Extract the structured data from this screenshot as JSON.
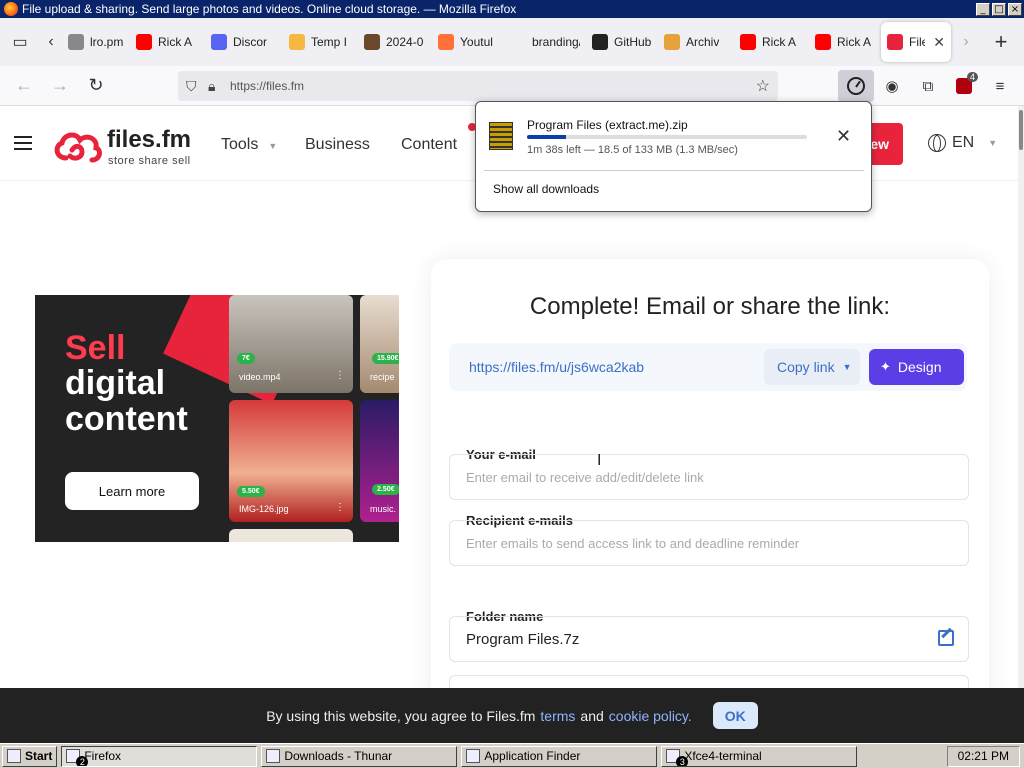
{
  "window": {
    "title": "File upload & sharing. Send large photos and videos. Online cloud storage. — Mozilla Firefox",
    "buttons": [
      "_",
      "□",
      "×"
    ]
  },
  "tabs": [
    {
      "label": "lro.pm",
      "fav": "#888888"
    },
    {
      "label": "Rick A",
      "fav": "#ff0000"
    },
    {
      "label": "Discor",
      "fav": "#5865f2"
    },
    {
      "label": "Temp I",
      "fav": "#f5b942"
    },
    {
      "label": "2024-0",
      "fav": "#6b4a2b"
    },
    {
      "label": "Youtul",
      "fav": "#ff7139"
    },
    {
      "label": "branding/ca",
      "fav": "#f0f0f4"
    },
    {
      "label": "GitHub",
      "fav": "#222222"
    },
    {
      "label": "Archiv",
      "fav": "#e8a23a"
    },
    {
      "label": "Rick A",
      "fav": "#ff0000"
    },
    {
      "label": "Rick A",
      "fav": "#ff0000"
    },
    {
      "label": "File",
      "fav": "#e8243d",
      "active": true
    }
  ],
  "nav": {
    "url": "https://files.fm",
    "downloads_badge": "4"
  },
  "site": {
    "logo_word": "files.fm",
    "logo_tag": "store share sell",
    "menu": {
      "tools": "Tools",
      "business": "Business",
      "content": "Content"
    },
    "red_button": "ew",
    "lang": "EN"
  },
  "promo": {
    "sell": "Sell",
    "line2": "digital",
    "line3": "content",
    "learn_more": "Learn more",
    "tiles": [
      {
        "price": "7€",
        "name": "video.mp4"
      },
      {
        "price": "15.90€",
        "name": "recipe"
      },
      {
        "price": "5.50€",
        "name": "IMG-126.jpg"
      },
      {
        "price": "2.50€",
        "name": "music."
      }
    ]
  },
  "share": {
    "heading": "Complete! Email or share the link:",
    "link": "https://files.fm/u/js6wca2kab",
    "copy_link": "Copy link",
    "design": "Design",
    "your_email_label": "Your e-mail",
    "your_email_placeholder": "Enter email to receive add/edit/delete link",
    "recipients_label": "Recipient e-mails",
    "recipients_placeholder": "Enter emails to send access link to and deadline reminder",
    "folder_label": "Folder name",
    "folder_value": "Program Files.7z"
  },
  "cookie": {
    "text_before": "By using this website, you agree to Files.fm",
    "terms": "terms",
    "and": "and",
    "policy": "cookie policy.",
    "ok": "OK"
  },
  "download": {
    "filename": "Program Files (extract.me).zip",
    "progress_fraction": 0.139,
    "status": "1m 38s left — 18.5 of 133 MB (1.3 MB/sec)",
    "show_all": "Show all downloads"
  },
  "taskbar": {
    "start": "Start",
    "items": [
      {
        "label": "Firefox",
        "num": "2",
        "pressed": true
      },
      {
        "label": "Downloads - Thunar"
      },
      {
        "label": "Application Finder"
      },
      {
        "label": "Xfce4-terminal",
        "num": "3"
      }
    ],
    "clock": "02:21 PM"
  }
}
